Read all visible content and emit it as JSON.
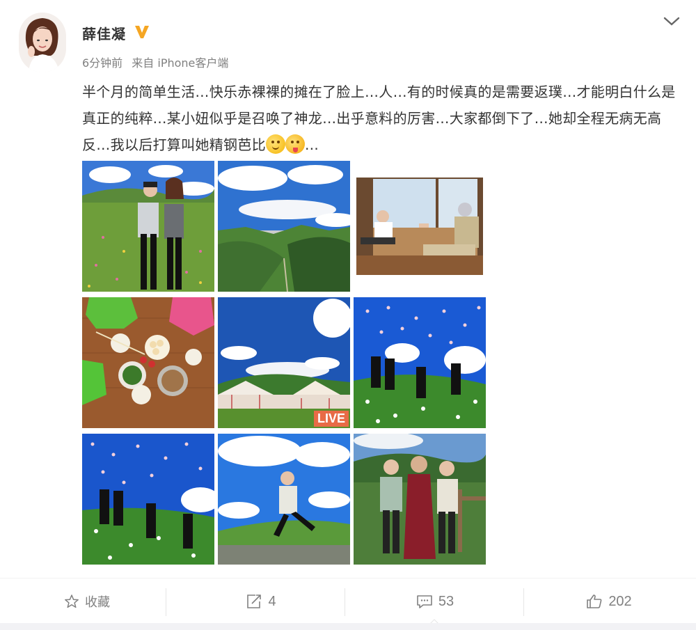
{
  "post": {
    "author": "薛佳凝",
    "time": "6分钟前",
    "source": "来自 iPhone客户端",
    "text_main": "半个月的简单生活…快乐赤裸裸的摊在了脸上…人…有的时候真的是需要返璞…才能明白什么是真正的纯粹…某小妞似乎是召唤了神龙…出乎意料的厉害…大家都倒下了…她却全程无病无高反…我以后打算叫她精钢芭比",
    "text_tail": "…",
    "emojis": [
      "smirk-emoji",
      "tongue-emoji"
    ],
    "live_label": "LIVE",
    "accent_color": "#ff8200",
    "badge_color": "#f5a623"
  },
  "photos": [
    {
      "name": "photo-two-women-meadow"
    },
    {
      "name": "photo-green-valley"
    },
    {
      "name": "photo-indoor-window"
    },
    {
      "name": "photo-table-food"
    },
    {
      "name": "photo-tents-sky",
      "live": true
    },
    {
      "name": "photo-jumping-group-1"
    },
    {
      "name": "photo-jumping-group-2"
    },
    {
      "name": "photo-jumping-woman"
    },
    {
      "name": "photo-group-with-monk"
    }
  ],
  "actions": {
    "favorite_label": "收藏",
    "repost_count": "4",
    "comment_count": "53",
    "like_count": "202"
  }
}
